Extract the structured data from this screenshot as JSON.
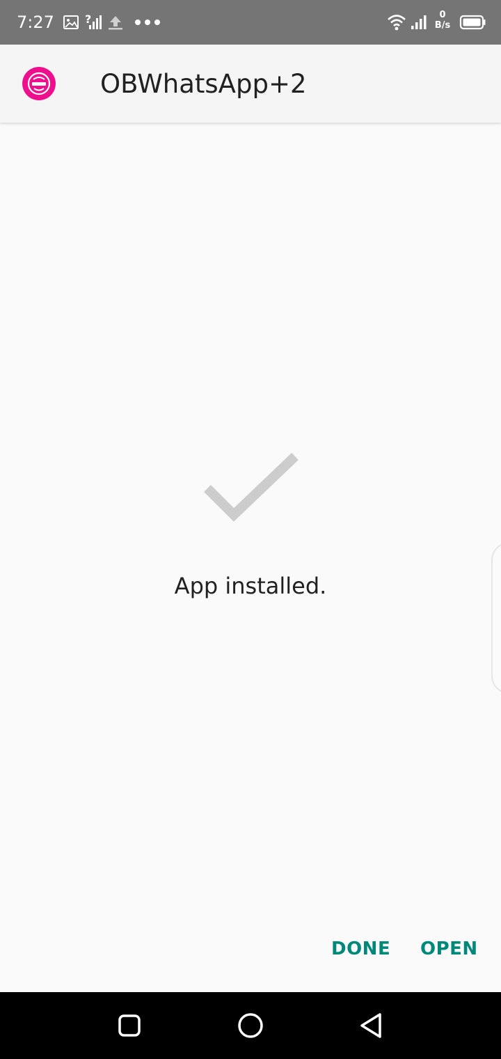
{
  "status_bar": {
    "time": "7:27",
    "net_speed_value": "0",
    "net_speed_unit": "B/s",
    "icons": [
      "image-icon",
      "signal-unknown-icon",
      "upload-icon",
      "more-dots-icon",
      "wifi-icon",
      "signal-icon",
      "battery-icon"
    ]
  },
  "header": {
    "title": "OBWhatsApp+2",
    "icon": "app-icon",
    "icon_color": "#ee0f8c"
  },
  "content": {
    "icon": "checkmark-icon",
    "message": "App installed."
  },
  "actions": {
    "done_label": "DONE",
    "open_label": "OPEN",
    "accent_color": "#00897b"
  },
  "nav_bar": {
    "icons": [
      "recents-icon",
      "home-icon",
      "back-icon"
    ]
  }
}
